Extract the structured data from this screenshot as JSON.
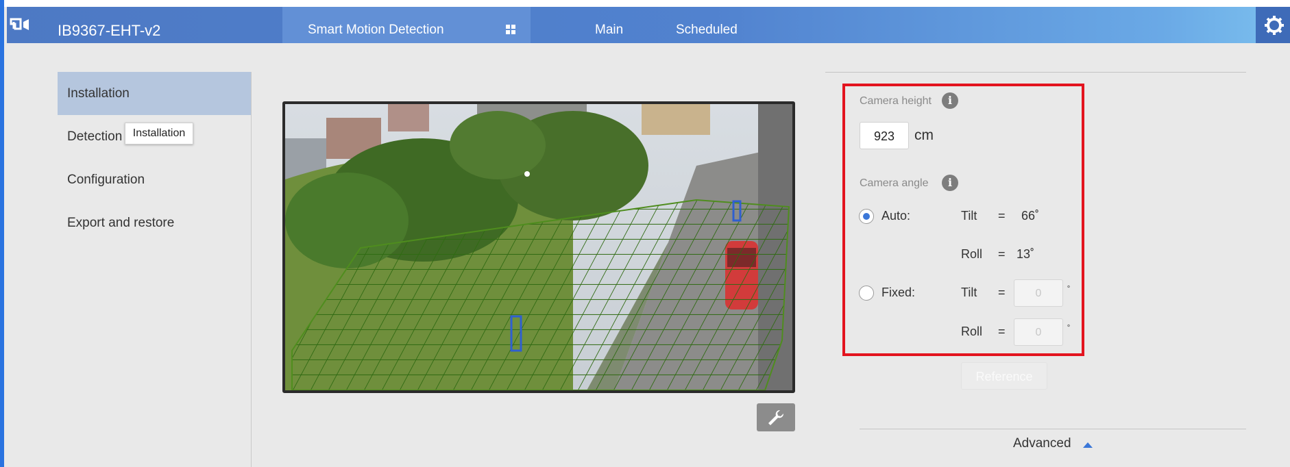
{
  "header": {
    "device_name": "IB9367-EHT-v2",
    "app_name": "Smart Motion Detection",
    "nav": [
      "Main",
      "Scheduled"
    ],
    "accent_color": "#5182cf"
  },
  "sidebar": {
    "items": [
      {
        "label": "Installation",
        "active": true
      },
      {
        "label": "Detection",
        "active": false
      },
      {
        "label": "Configuration",
        "active": false
      },
      {
        "label": "Export and restore",
        "active": false
      }
    ],
    "tooltip": "Installation"
  },
  "camera_view": {
    "icon": "camera-feed",
    "tool_icon": "wrench-icon"
  },
  "settings": {
    "camera_height": {
      "label": "Camera height",
      "value": "923",
      "unit": "cm"
    },
    "camera_angle": {
      "label": "Camera angle",
      "auto": {
        "label": "Auto:",
        "selected": true,
        "tilt_label": "Tilt",
        "tilt_eq": "=",
        "tilt_value": "66˚",
        "roll_label": "Roll",
        "roll_eq": "=",
        "roll_value": "13˚"
      },
      "fixed": {
        "label": "Fixed:",
        "selected": false,
        "tilt_label": "Tilt",
        "tilt_eq": "=",
        "tilt_placeholder": "0",
        "roll_label": "Roll",
        "roll_eq": "=",
        "roll_placeholder": "0",
        "degree_symbol": "˚"
      }
    },
    "reference_button": "Reference",
    "advanced_label": "Advanced",
    "highlight_color": "#e3141f"
  }
}
